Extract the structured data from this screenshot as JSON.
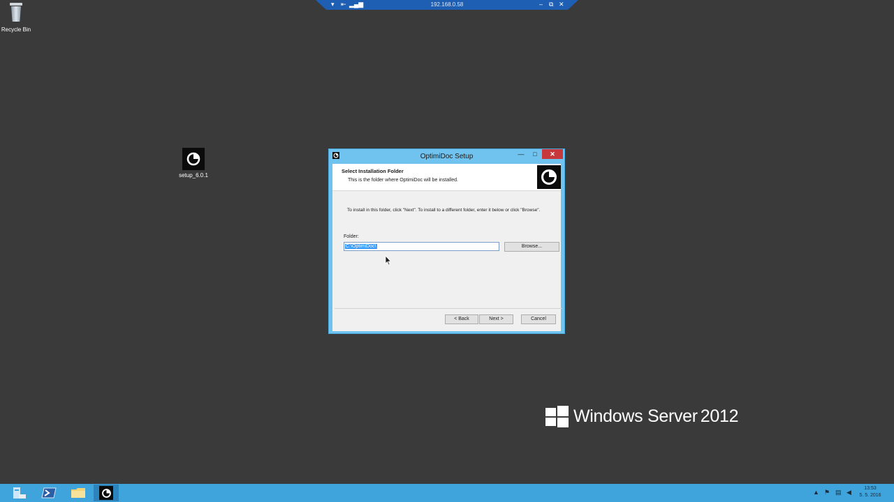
{
  "rdp_bar": {
    "title": "192.168.0.58",
    "pin_icon": "pin-icon",
    "signal_icon": "signal-icon",
    "minimize": "–",
    "restore": "⧉",
    "close": "✕"
  },
  "desktop": {
    "recycle_bin_label": "Recycle Bin",
    "setup_icon_label": "setup_6.0.1"
  },
  "dialog": {
    "title": "OptimiDoc Setup",
    "minimize": "—",
    "maximize": "□",
    "close": "✕",
    "header_title": "Select Installation Folder",
    "header_subtitle": "This is the folder where OptimiDoc will be installed.",
    "instructions": "To install in this folder, click \"Next\". To install to a different folder, enter it below or click \"Browse\".",
    "folder_label": "Folder:",
    "folder_value": "C:\\OptimiDoc\\",
    "browse_label": "Browse...",
    "back_label": "< Back",
    "next_label": "Next >",
    "cancel_label": "Cancel"
  },
  "branding": {
    "product": "Windows Server",
    "version": "2012"
  },
  "taskbar": {
    "items": [
      "server-manager-icon",
      "powershell-icon",
      "file-explorer-icon",
      "optimidoc-setup-icon"
    ],
    "clock_time": "13:53",
    "clock_date": "5. 5. 2016"
  },
  "colors": {
    "desktop": "#3a3a3a",
    "taskbar": "#3fa3dc",
    "dialog_frame": "#6fc3ee",
    "selection": "#3399ff"
  }
}
